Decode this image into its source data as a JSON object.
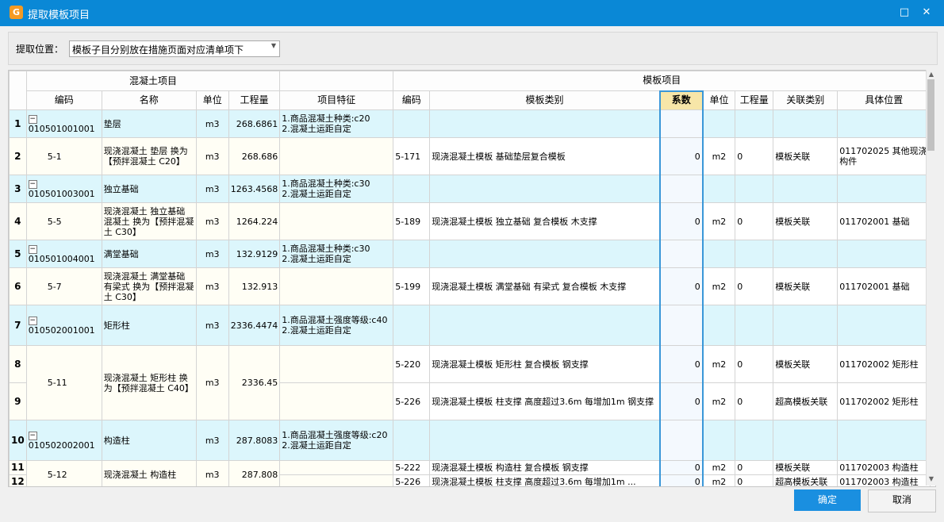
{
  "window": {
    "title": "提取模板项目",
    "icon": "app-logo-icon",
    "maximize_glyph": "□",
    "close_glyph": "✕"
  },
  "position": {
    "label": "提取位置：",
    "value": "模板子目分别放在措施页面对应清单项下"
  },
  "group_headers": {
    "concrete": "混凝土项目",
    "formwork": "模板项目"
  },
  "columns": {
    "c_code": "编码",
    "c_name": "名称",
    "c_unit": "单位",
    "c_qty": "工程量",
    "c_feature": "项目特征",
    "f_code": "编码",
    "f_type": "模板类别",
    "f_coef": "系数",
    "f_unit": "单位",
    "f_qty": "工程量",
    "f_rel": "关联类别",
    "f_pos": "具体位置"
  },
  "rows": [
    {
      "no": "1",
      "c_code": "010501001001",
      "c_name": "垫层",
      "c_unit": "m3",
      "c_qty": "268.6861",
      "c_feature": "1.商品混凝土种类:c20\n2.混凝土运距自定"
    },
    {
      "no": "2",
      "c_code": "5-1",
      "c_name": "现浇混凝土 垫层 换为【预拌混凝土 C20】",
      "c_unit": "m3",
      "c_qty": "268.686",
      "f_code": "5-171",
      "f_type": "现浇混凝土模板 基础垫层复合模板",
      "f_coef": "0",
      "f_unit": "m2",
      "f_qty": "0",
      "f_rel": "模板关联",
      "f_pos": "011702025  其他现浇构件"
    },
    {
      "no": "3",
      "c_code": "010501003001",
      "c_name": "独立基础",
      "c_unit": "m3",
      "c_qty": "1263.4568",
      "c_feature": "1.商品混凝土种类:c30\n2.混凝土运距自定"
    },
    {
      "no": "4",
      "c_code": "5-5",
      "c_name": "现浇混凝土 独立基础 混凝土 换为【预拌混凝土 C30】",
      "c_unit": "m3",
      "c_qty": "1264.224",
      "f_code": "5-189",
      "f_type": "现浇混凝土模板 独立基础 复合模板 木支撑",
      "f_coef": "0",
      "f_unit": "m2",
      "f_qty": "0",
      "f_rel": "模板关联",
      "f_pos": "011702001  基础"
    },
    {
      "no": "5",
      "c_code": "010501004001",
      "c_name": "满堂基础",
      "c_unit": "m3",
      "c_qty": "132.9129",
      "c_feature": "1.商品混凝土种类:c30\n2.混凝土运距自定"
    },
    {
      "no": "6",
      "c_code": "5-7",
      "c_name": "现浇混凝土 满堂基础 有梁式 换为【预拌混凝土 C30】",
      "c_unit": "m3",
      "c_qty": "132.913",
      "f_code": "5-199",
      "f_type": "现浇混凝土模板 满堂基础 有梁式 复合模板 木支撑",
      "f_coef": "0",
      "f_unit": "m2",
      "f_qty": "0",
      "f_rel": "模板关联",
      "f_pos": "011702001  基础"
    },
    {
      "no": "7",
      "c_code": "010502001001",
      "c_name": "矩形柱",
      "c_unit": "m3",
      "c_qty": "2336.4474",
      "c_feature": "1.商品混凝土强度等级:c40\n2.混凝土运距自定"
    },
    {
      "no": "8",
      "c_code": "5-11",
      "c_name": "现浇混凝土 矩形柱 换为【预拌混凝土 C40】",
      "c_unit": "m3",
      "c_qty": "2336.45",
      "f_code": "5-220",
      "f_type": "现浇混凝土模板 矩形柱 复合模板 钢支撑",
      "f_coef": "0",
      "f_unit": "m2",
      "f_qty": "0",
      "f_rel": "模板关联",
      "f_pos": "011702002  矩形柱"
    },
    {
      "no": "9",
      "f_code": "5-226",
      "f_type": "现浇混凝土模板 柱支撑 高度超过3.6m 每增加1m 钢支撑",
      "f_coef": "0",
      "f_unit": "m2",
      "f_qty": "0",
      "f_rel": "超高模板关联",
      "f_pos": "011702002  矩形柱"
    },
    {
      "no": "10",
      "c_code": "010502002001",
      "c_name": "构造柱",
      "c_unit": "m3",
      "c_qty": "287.8083",
      "c_feature": "1.商品混凝土强度等级:c20\n2.混凝土运距自定"
    },
    {
      "no": "11",
      "c_code": "5-12",
      "c_name": "现浇混凝土 构造柱",
      "c_unit": "m3",
      "c_qty": "287.808",
      "f_code": "5-222",
      "f_type": "现浇混凝土模板 构造柱 复合模板 钢支撑",
      "f_coef": "0",
      "f_unit": "m2",
      "f_qty": "0",
      "f_rel": "模板关联",
      "f_pos": "011702003  构造柱"
    },
    {
      "no": "12",
      "f_code": "5-226",
      "f_type": "现浇混凝土模板 柱支撑 高度超过3.6m 每增加1m ...",
      "f_coef": "0",
      "f_unit": "m2",
      "f_qty": "0",
      "f_rel": "超高模板关联",
      "f_pos": "011702003  构造柱"
    }
  ],
  "buttons": {
    "ok": "确定",
    "cancel": "取消"
  },
  "colors": {
    "titlebar": "#0a88d6",
    "parent_row": "#dcf6fc",
    "row_number": "#fbefc4",
    "coef_border": "#3a97d8",
    "ok_button": "#1a8fe0"
  }
}
